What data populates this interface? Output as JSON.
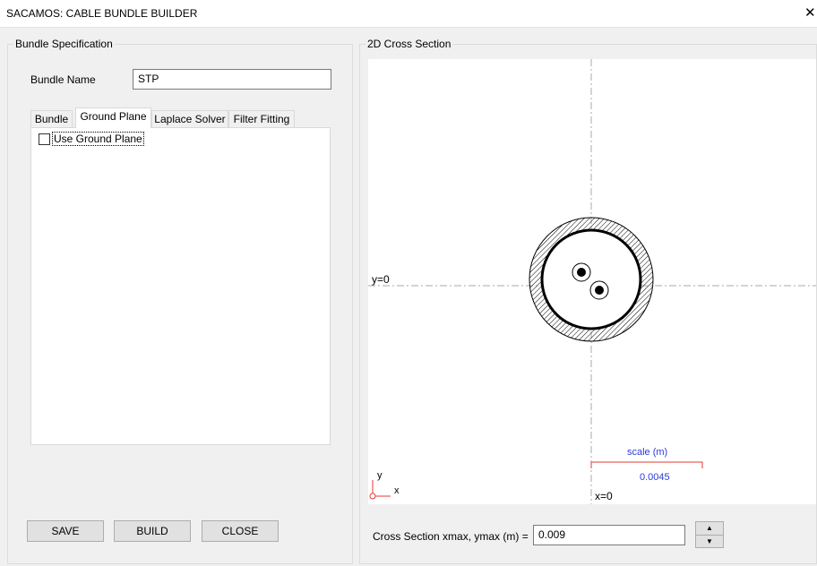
{
  "window": {
    "title": "SACAMOS: CABLE BUNDLE BUILDER",
    "close_glyph": "✕"
  },
  "bundle_spec": {
    "group_title": "Bundle Specification",
    "name_label": "Bundle Name",
    "name_value": "STP",
    "tabs": [
      {
        "label": "Bundle",
        "active": false
      },
      {
        "label": "Ground Plane",
        "active": true
      },
      {
        "label": "Laplace Solver",
        "active": false
      },
      {
        "label": "Filter Fitting",
        "active": false
      }
    ],
    "use_ground_plane": {
      "label": "Use Ground Plane",
      "checked": false
    }
  },
  "buttons": {
    "save": "SAVE",
    "build": "BUILD",
    "close": "CLOSE"
  },
  "cross_section": {
    "group_title": "2D Cross Section",
    "y0_label": "y=0",
    "x0_label": "x=0",
    "axis_y_label": "y",
    "axis_x_label": "x",
    "scale_title": "scale (m)",
    "scale_value": "0.0045",
    "xmax_label": "Cross Section xmax, ymax (m) =",
    "xmax_value": "0.009",
    "spin_up_glyph": "▲",
    "spin_down_glyph": "▼"
  },
  "colors": {
    "scale_line": "#e53935",
    "scale_text": "#2b3bd6",
    "axis_origin": "#e53935",
    "centerline": "#aaaaaa"
  }
}
